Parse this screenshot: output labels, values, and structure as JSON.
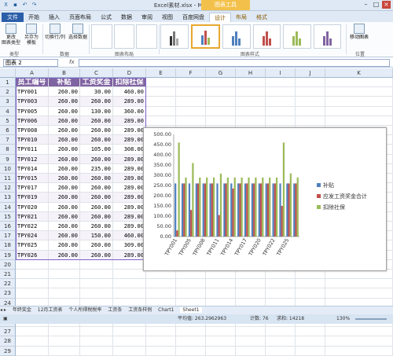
{
  "window": {
    "title": "Excel素材.xlsx - Microsoft Excel",
    "contextual_tab": "图表工具"
  },
  "tabs": [
    "文件",
    "开始",
    "插入",
    "页面布局",
    "公式",
    "数据",
    "审阅",
    "视图",
    "百度网盘",
    "设计",
    "布局",
    "格式"
  ],
  "ribbon": {
    "buttons": [
      {
        "label": "更改\n图表类型"
      },
      {
        "label": "另存为\n模板"
      },
      {
        "label": "切换行/列"
      },
      {
        "label": "选择数据"
      }
    ],
    "groups": [
      "类型",
      "数据",
      "图表布局",
      "图表样式",
      "位置"
    ],
    "move_chart": "移动图表"
  },
  "formula_bar": {
    "name_box": "图表 2",
    "fx": "fx",
    "value": ""
  },
  "columns": [
    "A",
    "B",
    "C",
    "D",
    "E",
    "F",
    "G",
    "H",
    "I",
    "J",
    "K"
  ],
  "rows": [
    "1",
    "2",
    "3",
    "4",
    "5",
    "6",
    "7",
    "8",
    "9",
    "10",
    "11",
    "12",
    "13",
    "14",
    "15",
    "16",
    "17",
    "18",
    "19",
    "20",
    "21",
    "22",
    "23",
    "24",
    "25",
    "26",
    "27",
    "28",
    "29"
  ],
  "table": {
    "headers": [
      "员工编号",
      "补贴",
      "工资奖金",
      "扣除社保"
    ],
    "rows": [
      [
        "TPY001",
        "260.00",
        "30.00",
        "460.00"
      ],
      [
        "TPY003",
        "260.00",
        "260.00",
        "289.00"
      ],
      [
        "TPY005",
        "260.00",
        "130.00",
        "360.00"
      ],
      [
        "TPY006",
        "260.00",
        "260.00",
        "289.00"
      ],
      [
        "TPY008",
        "260.00",
        "260.00",
        "289.00"
      ],
      [
        "TPY010",
        "260.00",
        "260.00",
        "289.00"
      ],
      [
        "TPY011",
        "260.00",
        "105.00",
        "308.00"
      ],
      [
        "TPY012",
        "260.00",
        "260.00",
        "289.00"
      ],
      [
        "TPY014",
        "260.00",
        "235.00",
        "289.00"
      ],
      [
        "TPY015",
        "260.00",
        "260.00",
        "289.00"
      ],
      [
        "TPY017",
        "260.00",
        "260.00",
        "289.00"
      ],
      [
        "TPY019",
        "260.00",
        "260.00",
        "289.00"
      ],
      [
        "TPY020",
        "260.00",
        "260.00",
        "289.00"
      ],
      [
        "TPY021",
        "260.00",
        "260.00",
        "289.00"
      ],
      [
        "TPY022",
        "260.00",
        "260.00",
        "289.00"
      ],
      [
        "TPY024",
        "260.00",
        "150.00",
        "460.00"
      ],
      [
        "TPY025",
        "260.00",
        "260.00",
        "309.00"
      ],
      [
        "TPY026",
        "260.00",
        "260.00",
        "289.00"
      ]
    ]
  },
  "chart_data": {
    "type": "bar",
    "categories": [
      "TPY001",
      "TPY003",
      "TPY005",
      "TPY006",
      "TPY008",
      "TPY010",
      "TPY011",
      "TPY012",
      "TPY014",
      "TPY015",
      "TPY017",
      "TPY019",
      "TPY020",
      "TPY021",
      "TPY022",
      "TPY024",
      "TPY025",
      "TPY026"
    ],
    "x_tick_labels": [
      "TPY001",
      "TPY005",
      "TPY008",
      "TPY011",
      "TPY014",
      "TPY017",
      "TPY020",
      "TPY022",
      "TPY025"
    ],
    "series": [
      {
        "name": "补贴",
        "color": "#4f81bd",
        "values": [
          260,
          260,
          260,
          260,
          260,
          260,
          260,
          260,
          260,
          260,
          260,
          260,
          260,
          260,
          260,
          260,
          260,
          260
        ]
      },
      {
        "name": "应发工资奖金合计",
        "color": "#c0504d",
        "values": [
          30,
          260,
          130,
          260,
          260,
          260,
          105,
          260,
          235,
          260,
          260,
          260,
          260,
          260,
          260,
          150,
          260,
          260
        ]
      },
      {
        "name": "扣除社保",
        "color": "#9bbb59",
        "values": [
          460,
          289,
          360,
          289,
          289,
          289,
          308,
          289,
          289,
          289,
          289,
          289,
          289,
          289,
          289,
          460,
          309,
          289
        ]
      }
    ],
    "ylim": [
      0,
      500
    ],
    "yticks": [
      "0.00",
      "50.00",
      "100.00",
      "150.00",
      "200.00",
      "250.00",
      "300.00",
      "350.00",
      "400.00",
      "450.00",
      "500.00"
    ],
    "legend": "right",
    "grid": false
  },
  "sheet_tabs": [
    "年终奖金",
    "12月工资表",
    "个人所得税税率",
    "工资条",
    "工资条样例",
    "Chart1",
    "Sheet1"
  ],
  "status": {
    "average": "平均值: 263.2962963",
    "count": "计数: 76",
    "sum": "求和: 14218",
    "zoom": "130%"
  }
}
